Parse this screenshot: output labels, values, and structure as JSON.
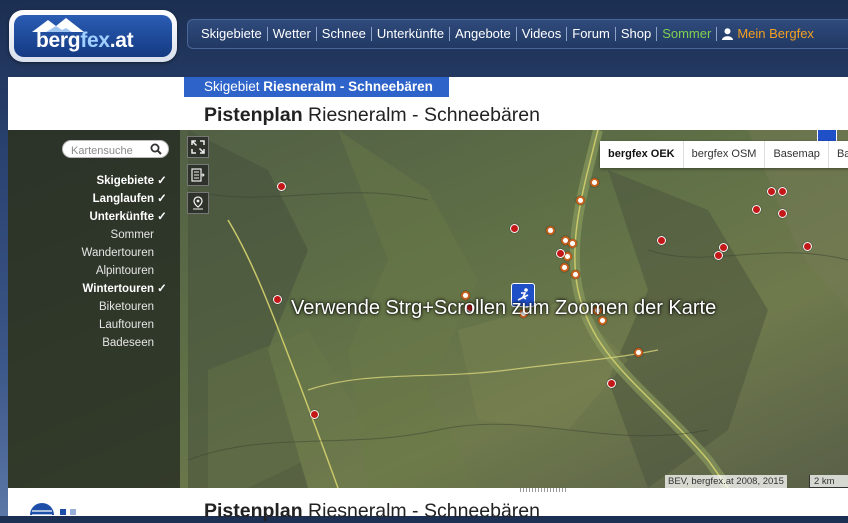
{
  "header": {
    "logo": {
      "part1": "berg",
      "part2": "fex",
      "part3": ".at"
    },
    "nav": [
      "Skigebiete",
      "Wetter",
      "Schnee",
      "Unterkünfte",
      "Angebote",
      "Videos",
      "Forum",
      "Shop",
      "Sommer"
    ],
    "mein_bergfex": "Mein Bergfex"
  },
  "breadcrumb": {
    "prefix": "Skigebiet ",
    "name": "Riesneralm - Schneebären"
  },
  "page_title": {
    "bold": "Pistenplan",
    "rest": " Riesneralm - Schneebären"
  },
  "map": {
    "search_placeholder": "Kartensuche",
    "layers": [
      {
        "label": "Skigebiete",
        "active": true
      },
      {
        "label": "Langlaufen",
        "active": true
      },
      {
        "label": "Unterkünfte",
        "active": true
      },
      {
        "label": "Sommer",
        "active": false
      },
      {
        "label": "Wandertouren",
        "active": false
      },
      {
        "label": "Alpintouren",
        "active": false
      },
      {
        "label": "Wintertouren",
        "active": true
      },
      {
        "label": "Biketouren",
        "active": false
      },
      {
        "label": "Lauftouren",
        "active": false
      },
      {
        "label": "Badeseen",
        "active": false
      }
    ],
    "check_glyph": "✓",
    "basemap_tabs": [
      "bergfex OEK",
      "bergfex OSM",
      "Basemap",
      "Bas"
    ],
    "zoom_hint": "Verwende Strg+Scrollen zum Zoomen der Karte",
    "attribution": "BEV, bergfex.at 2008, 2015",
    "scale_label": "2 km"
  },
  "colors": {
    "accent": "#2e63c9",
    "sommer": "#7fd050",
    "mein": "#f4a020",
    "marker": "#c41818"
  }
}
